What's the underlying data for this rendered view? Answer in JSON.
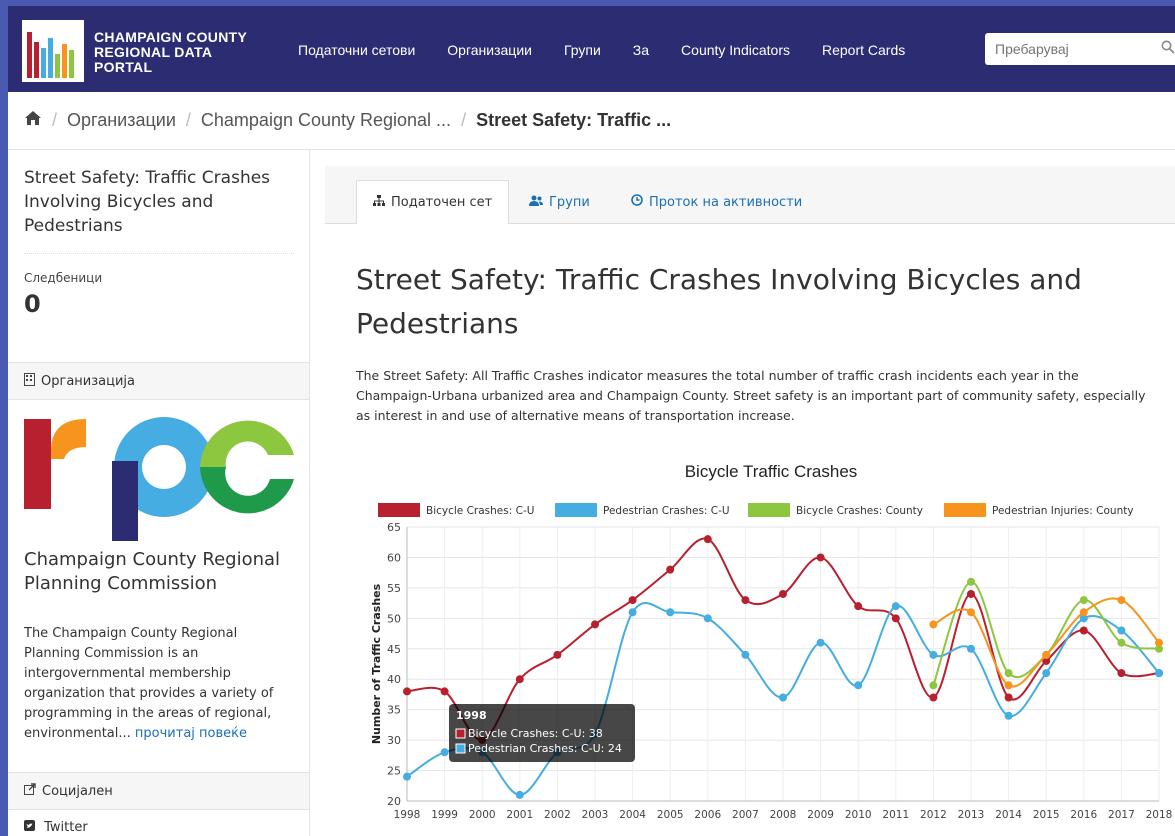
{
  "header": {
    "logo_text": [
      "CHAMPAIGN COUNTY",
      "REGIONAL DATA",
      "PORTAL"
    ],
    "nav": [
      "Податочни сетови",
      "Организации",
      "Групи",
      "За",
      "County Indicators",
      "Report Cards"
    ],
    "search_placeholder": "Пребарувај"
  },
  "breadcrumb": {
    "items": [
      "Организации",
      "Champaign County Regional ...",
      "Street Safety: Traffic ..."
    ]
  },
  "sidebar": {
    "title": "Street Safety: Traffic Crashes Involving Bicycles and Pedestrians",
    "followers_label": "Следбеници",
    "followers_value": "0",
    "org_section_label": "Организација",
    "org_logo_text": "rpc",
    "org_name": "Champaign County Regional Planning Commission",
    "org_description": "The Champaign County Regional Planning Commission is an intergovernmental membership organization that provides a variety of programming in the areas of regional, environmental...",
    "read_more": "прочитај повеќе",
    "social_label": "Социјален",
    "twitter_label": "Twitter"
  },
  "tabs": [
    "Податочен сет",
    "Групи",
    "Проток на активности"
  ],
  "dataset": {
    "title": "Street Safety: Traffic Crashes Involving Bicycles and Pedestrians",
    "description": "The Street Safety: All Traffic Crashes indicator measures the total number of traffic crash incidents each year in the Champaign-Urbana urbanized area and Champaign County. Street safety is an important part of community safety, especially as interest in and use of alternative means of transportation increase."
  },
  "colors": {
    "red": "#b8202f",
    "blue": "#45ade2",
    "green": "#8dc63f",
    "orange": "#f7941d",
    "navy": "#2b2c72"
  },
  "chart_data": {
    "type": "line",
    "title": "Bicycle Traffic Crashes",
    "ylabel": "Number of Traffic Crashes",
    "xlabel": "",
    "ylim": [
      20,
      65
    ],
    "yticks": [
      20,
      25,
      30,
      35,
      40,
      45,
      50,
      55,
      60,
      65
    ],
    "grid": true,
    "legend_position": "top",
    "x": [
      1998,
      1999,
      2000,
      2001,
      2002,
      2003,
      2004,
      2005,
      2006,
      2007,
      2008,
      2009,
      2010,
      2011,
      2012,
      2013,
      2014,
      2015,
      2016,
      2017,
      2018
    ],
    "series": [
      {
        "name": "Bicycle Crashes: C-U",
        "color": "#b8202f",
        "values": [
          38,
          38,
          30,
          40,
          44,
          49,
          53,
          58,
          63,
          53,
          54,
          60,
          52,
          50,
          37,
          54,
          37,
          43,
          48,
          41,
          41
        ]
      },
      {
        "name": "Pedestrian Crashes: C-U",
        "color": "#45ade2",
        "values": [
          24,
          28,
          28,
          21,
          28,
          31,
          51,
          51,
          50,
          44,
          37,
          46,
          39,
          52,
          44,
          45,
          34,
          41,
          50,
          48,
          41
        ]
      },
      {
        "name": "Bicycle Crashes: County",
        "color": "#8dc63f",
        "values": [
          null,
          null,
          null,
          null,
          null,
          null,
          null,
          null,
          null,
          null,
          null,
          null,
          null,
          null,
          39,
          56,
          41,
          44,
          53,
          46,
          45
        ]
      },
      {
        "name": "Pedestrian Injuries: County",
        "color": "#f7941d",
        "values": [
          null,
          null,
          null,
          null,
          null,
          null,
          null,
          null,
          null,
          null,
          null,
          null,
          null,
          null,
          49,
          51,
          39,
          44,
          51,
          53,
          46
        ]
      }
    ],
    "tooltip": {
      "title": "1998",
      "lines": [
        "Bicycle Crashes: C-U: 38",
        "Pedestrian Crashes: C-U: 24"
      ]
    }
  }
}
